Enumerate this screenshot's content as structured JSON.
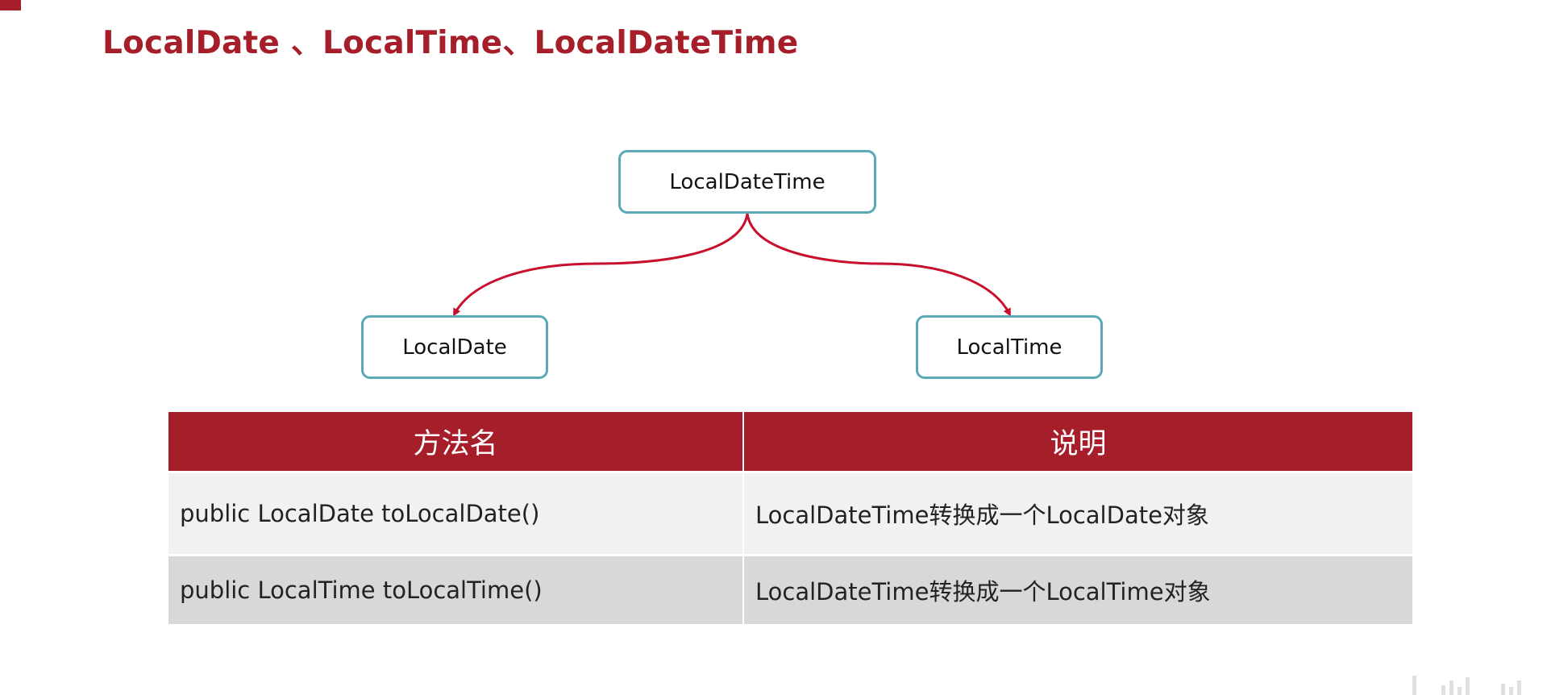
{
  "title": "LocalDate 、LocalTime、LocalDateTime",
  "diagram": {
    "root": "LocalDateTime",
    "left": "LocalDate",
    "right": "LocalTime"
  },
  "table": {
    "headers": [
      "方法名",
      "说明"
    ],
    "rows": [
      {
        "method": "public LocalDate toLocalDate()",
        "description": "LocalDateTime转换成一个LocalDate对象"
      },
      {
        "method": "public LocalTime toLocalTime()",
        "description": "LocalDateTime转换成一个LocalTime对象"
      }
    ]
  },
  "colors": {
    "accent": "#a51e2a",
    "node_border": "#5aa9b7",
    "arrow": "#c8102e",
    "row_odd": "#f1f1f1",
    "row_even": "#d8d8d8"
  }
}
